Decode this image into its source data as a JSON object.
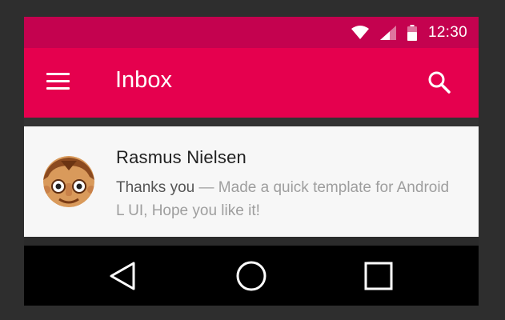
{
  "statusbar": {
    "time": "12:30"
  },
  "appbar": {
    "title": "Inbox"
  },
  "message": {
    "sender": "Rasmus Nielsen",
    "subject": "Thanks you",
    "separator": " — ",
    "snippet": "Made a quick template for Android L UI, Hope you like it!"
  },
  "icons": {
    "wifi": "wifi-icon",
    "signal": "signal-icon",
    "battery": "battery-icon",
    "menu": "menu-icon",
    "search": "search-icon",
    "back": "back-icon",
    "home": "home-icon",
    "recents": "recents-icon"
  },
  "colors": {
    "statusbar": "#c4024f",
    "appbar": "#e5004e",
    "card": "#f7f7f7",
    "navbar": "#000000"
  }
}
